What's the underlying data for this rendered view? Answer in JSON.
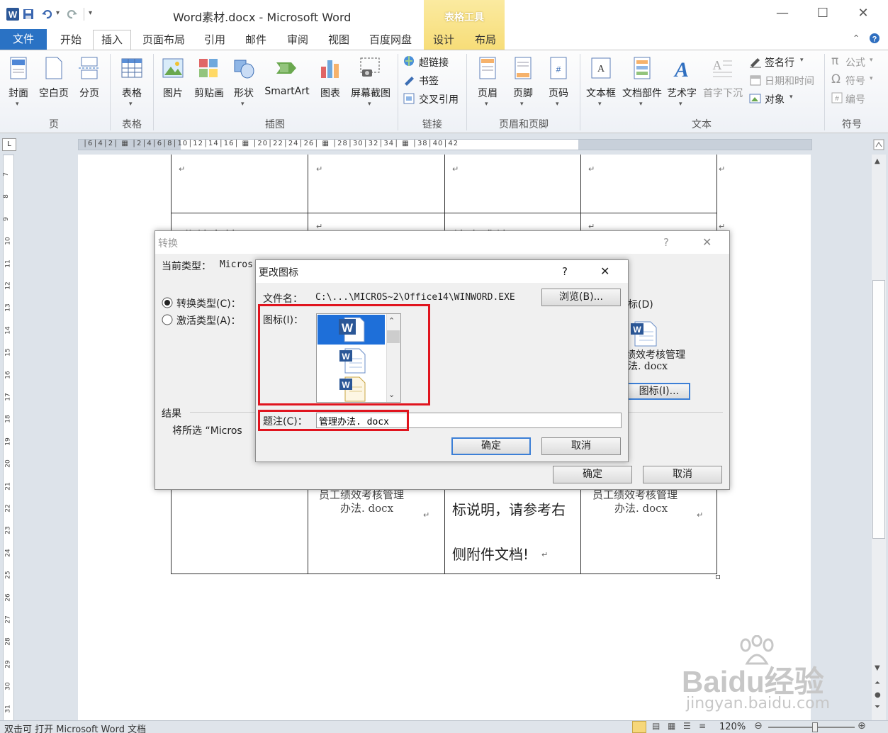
{
  "window": {
    "title": "Word素材.docx - Microsoft Word",
    "context_tab_header": "表格工具",
    "controls": {
      "minimize": "—",
      "maximize": "☐",
      "close": "✕"
    }
  },
  "tabs": {
    "file": "文件",
    "items": [
      "开始",
      "插入",
      "页面布局",
      "引用",
      "邮件",
      "审阅",
      "视图",
      "百度网盘",
      "设计",
      "布局"
    ]
  },
  "ribbon": {
    "groups": {
      "pages": {
        "label": "页",
        "buttons": [
          "封面",
          "空白页",
          "分页"
        ]
      },
      "tables": {
        "label": "表格",
        "buttons": [
          "表格"
        ]
      },
      "illustrations": {
        "label": "插图",
        "buttons": [
          "图片",
          "剪贴画",
          "形状",
          "SmartArt",
          "图表",
          "屏幕截图"
        ]
      },
      "links": {
        "label": "链接",
        "items": [
          "超链接",
          "书签",
          "交叉引用"
        ]
      },
      "header_footer": {
        "label": "页眉和页脚",
        "buttons": [
          "页眉",
          "页脚",
          "页码"
        ]
      },
      "text": {
        "label": "文本",
        "buttons": [
          "文本框",
          "文档部件",
          "艺术字",
          "首字下沉"
        ],
        "small_items": [
          "签名行",
          "日期和时间",
          "对象"
        ]
      },
      "symbols": {
        "label": "符号",
        "items": [
          "公式",
          "符号",
          "编号"
        ]
      }
    }
  },
  "ruler": {
    "text": "│6│4│2│ ▦ │2│4│6│8│10│12│14│16│ ▦ │20│22│24│26│ ▦ │28│30│32│34│ ▦ │38│40│42"
  },
  "vruler": {
    "numbers": [
      "7",
      "8",
      "9",
      "10",
      "11",
      "12",
      "13",
      "14",
      "15",
      "16",
      "17",
      "18",
      "19",
      "20",
      "21",
      "22",
      "23",
      "24",
      "25",
      "26",
      "27",
      "28",
      "29",
      "30",
      "31"
    ]
  },
  "document": {
    "cell_text": {
      "row2_col1": "业绩考核",
      "row2_col3": "综合成绩",
      "bottom_col2_line1": "员工绩效考核管理",
      "bottom_col2_line2": "办法. docx",
      "bottom_col3_line1": "标说明，请参考右",
      "bottom_col3_line2": "侧附件文档!",
      "bottom_col4_line1": "员工绩效考核管理",
      "bottom_col4_line2": "办法. docx"
    },
    "para_mark": "↵"
  },
  "convert_dialog": {
    "title": "转换",
    "help": "?",
    "close": "✕",
    "current_type_label": "当前类型：",
    "current_type_value": "Micros",
    "radio_convert": "转换类型(C)：",
    "radio_activate": "激活类型(A)：",
    "display_as_icon_partial": "标(D)",
    "icon_caption_line1": "绩效考核管理",
    "icon_caption_line2": "法. docx",
    "change_icon_btn": "图标(I)...",
    "result_label": "结果",
    "result_text": "将所选 “Micros",
    "ok": "确定",
    "cancel": "取消"
  },
  "change_icon_dialog": {
    "title": "更改图标",
    "help": "?",
    "close": "✕",
    "filename_label": "文件名：",
    "filename_value": "C:\\...\\MICROS~2\\Office14\\WINWORD.EXE",
    "browse": "浏览(B)...",
    "icon_label": "图标(I)：",
    "caption_label": "题注(C)：",
    "caption_value": "管理办法. docx",
    "ok": "确定",
    "cancel": "取消"
  },
  "statusbar": {
    "message": "双击可 打开 Microsoft Word 文档",
    "zoom": "120%"
  },
  "watermark": {
    "brand": "Baidu经验",
    "url": "jingyan.baidu.com"
  },
  "colors": {
    "file_tab": "#2a72c4",
    "context_header": "#f7dd78",
    "highlight_red": "#e0141e",
    "selection_blue": "#1e6fd9"
  }
}
